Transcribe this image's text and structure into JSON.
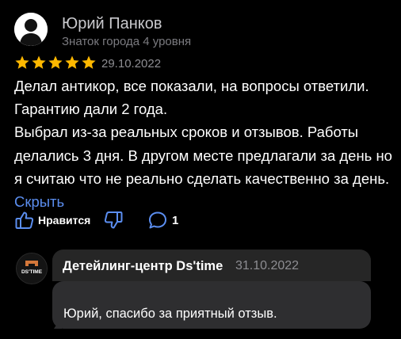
{
  "review": {
    "author_name": "Юрий Панков",
    "author_level": "Знаток города 4 уровня",
    "rating": 5,
    "rating_max": 5,
    "date": "29.10.2022",
    "text_lines": [
      "Делал антикор, все показали, на вопросы ответили. Гарантию дали 2 года.",
      "Выбрал из-за реальных сроков и отзывов. Работы делались 3 дня. В другом месте предлагали за день но я считаю что не реально сделать качественно за день."
    ],
    "collapse_label": "Скрыть",
    "like_label": "Нравится",
    "comments_count": "1"
  },
  "reply": {
    "avatar_logo_text": "DS'TIME",
    "organization": "Детейлинг-центр Ds'time",
    "date": "31.10.2022",
    "text": "Юрий, спасибо за приятный отзыв."
  },
  "icons": {
    "avatar": "person-silhouette-icon",
    "star": "star-icon",
    "like": "thumbs-up-icon",
    "dislike": "thumbs-down-icon",
    "comment": "comment-bubble-icon"
  },
  "colors": {
    "background": "#000000",
    "star": "#ffb800",
    "link": "#5b8ef0",
    "secondary_text": "#8d8d92",
    "bubble": "#2e2e30"
  }
}
